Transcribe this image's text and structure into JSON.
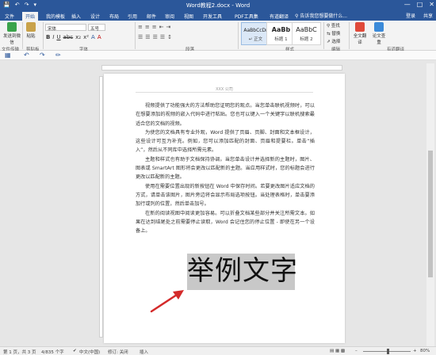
{
  "window": {
    "title": "Word教程2.docx - Word",
    "controls": [
      "—",
      "□",
      "✕"
    ]
  },
  "quick_access": [
    "💾",
    "↶",
    "↷",
    "▾"
  ],
  "tabs": [
    "文件",
    "开始",
    "我的模板",
    "插入",
    "设计",
    "布局",
    "引用",
    "邮件",
    "审阅",
    "视图",
    "开发工具",
    "PDF工具集",
    "有道翻译"
  ],
  "active_tab": "开始",
  "search_placeholder": "告诉我您想要做什么...",
  "user": {
    "login": "登录",
    "share": "共享"
  },
  "ribbon": {
    "file_group": {
      "btn": "发送到微信",
      "label": "文件传输"
    },
    "clipboard": {
      "paste": "粘贴",
      "label": "剪贴板"
    },
    "font": {
      "name": "宋体",
      "size": "五号",
      "label": "字体",
      "buttons": [
        "B",
        "I",
        "U",
        "abc",
        "x₂",
        "x²",
        "A",
        "A"
      ]
    },
    "paragraph": {
      "label": "段落"
    },
    "styles": {
      "label": "样式",
      "items": [
        {
          "sample": "AaBbCcDr",
          "name": "↵ 正文"
        },
        {
          "sample": "AaBb",
          "name": "标题 1"
        },
        {
          "sample": "AaBbC",
          "name": "标题 2"
        }
      ]
    },
    "editing": {
      "find": "查找",
      "replace": "替换",
      "select": "选择",
      "label": "编辑"
    },
    "translate": {
      "full": "全文翻译",
      "paper": "论文查重",
      "label": "有道翻译"
    }
  },
  "document": {
    "header": "XXX 公司",
    "paragraphs": [
      "视频提供了功能强大的方法帮助您证明您的观点。当您单击联机视频时，可以在想要添加的视频的嵌入代码中进行粘贴。您也可以键入一个关键字以联机搜索最适合您的文档的视频。",
      "为使您的文档具有专业外观，Word 提供了页眉、页脚、封面和文本框设计，这些设计可互为补充。例如，您可以添加匹配的封面、页眉和提要栏。单击“插入”，然后从不同库中选择所需元素。",
      "主题和样式也有助于文档保持协调。当您单击设计并选择新的主题时，图片、图表或 SmartArt 图形将会更改以匹配新的主题。当应用样式时，您的标题会进行更改以匹配新的主题。",
      "使用在需要位置出现的新按钮在 Word 中保存时间。若要更改图片适应文档的方式，请单击该图片，图片旁边将会显示布局选项按钮。当处理表格时，单击要添加行或列的位置，然后单击加号。",
      "在新的阅读视图中阅读更加容易。可以折叠文档某些部分并关注所需文本。如果在达到结尾处之前需要停止读取，Word 会记住您的停止位置 - 即使在另一个设备上。"
    ],
    "big_text": "举例文字"
  },
  "status": {
    "page": "第 1 页，共 3 页",
    "words": "4/835 个字",
    "proof": "✔",
    "lang": "中文(中国)",
    "modify": "修订: 关闭",
    "insert": "插入",
    "zoom": "80%"
  }
}
